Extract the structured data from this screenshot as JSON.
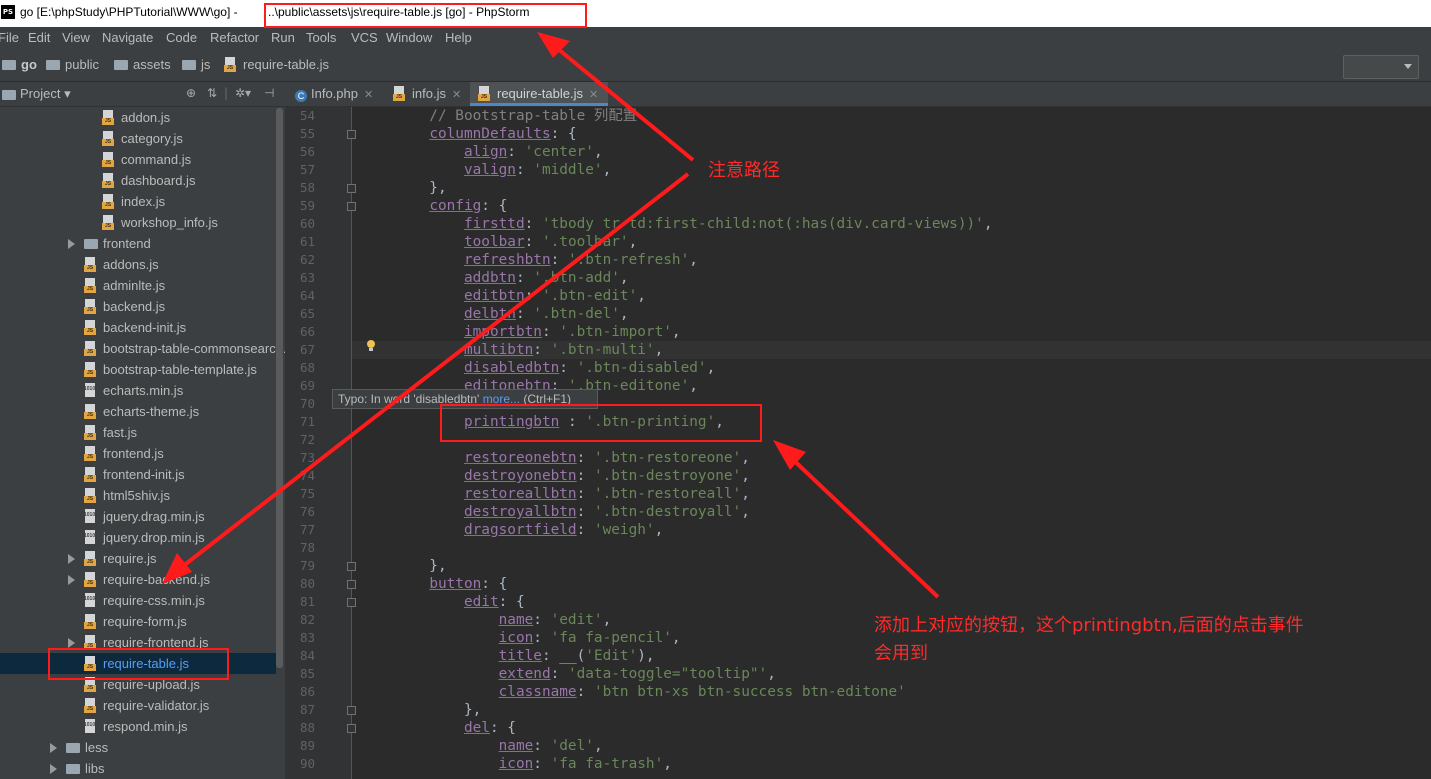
{
  "window": {
    "app_icon": "PS",
    "title_prefix": "go [E:\\phpStudy\\PHPTutorial\\WWW\\go] -",
    "title_path": "..\\public\\assets\\js\\require-table.js [go] - PhpStorm"
  },
  "menu": [
    "File",
    "Edit",
    "View",
    "Navigate",
    "Code",
    "Refactor",
    "Run",
    "Tools",
    "VCS",
    "Window",
    "Help"
  ],
  "breadcrumb": [
    "go",
    "public",
    "assets",
    "js",
    "require-table.js"
  ],
  "project_panel": {
    "title": "Project",
    "tree": [
      {
        "label": "addon.js",
        "icon": "js-file-icon"
      },
      {
        "label": "category.js",
        "icon": "js-file-icon"
      },
      {
        "label": "command.js",
        "icon": "js-file-icon"
      },
      {
        "label": "dashboard.js",
        "icon": "js-file-icon"
      },
      {
        "label": "index.js",
        "icon": "js-file-icon"
      },
      {
        "label": "workshop_info.js",
        "icon": "js-file-icon"
      },
      {
        "label": "frontend",
        "icon": "folder-icon"
      },
      {
        "label": "addons.js",
        "icon": "js-file-icon"
      },
      {
        "label": "adminlte.js",
        "icon": "js-file-icon"
      },
      {
        "label": "backend.js",
        "icon": "js-file-icon"
      },
      {
        "label": "backend-init.js",
        "icon": "js-file-icon"
      },
      {
        "label": "bootstrap-table-commonsearch.js",
        "icon": "js-file-icon"
      },
      {
        "label": "bootstrap-table-template.js",
        "icon": "js-file-icon"
      },
      {
        "label": "echarts.min.js",
        "icon": "binary-file-icon"
      },
      {
        "label": "echarts-theme.js",
        "icon": "js-file-icon"
      },
      {
        "label": "fast.js",
        "icon": "js-file-icon"
      },
      {
        "label": "frontend.js",
        "icon": "js-file-icon"
      },
      {
        "label": "frontend-init.js",
        "icon": "js-file-icon"
      },
      {
        "label": "html5shiv.js",
        "icon": "js-file-icon"
      },
      {
        "label": "jquery.drag.min.js",
        "icon": "binary-file-icon"
      },
      {
        "label": "jquery.drop.min.js",
        "icon": "binary-file-icon"
      },
      {
        "label": "require.js",
        "icon": "js-file-icon"
      },
      {
        "label": "require-backend.js",
        "icon": "js-file-icon"
      },
      {
        "label": "require-css.min.js",
        "icon": "binary-file-icon"
      },
      {
        "label": "require-form.js",
        "icon": "js-file-icon"
      },
      {
        "label": "require-frontend.js",
        "icon": "js-file-icon"
      },
      {
        "label": "require-table.js",
        "icon": "js-file-icon",
        "selected": true
      },
      {
        "label": "require-upload.js",
        "icon": "js-file-icon"
      },
      {
        "label": "require-validator.js",
        "icon": "js-file-icon"
      },
      {
        "label": "respond.min.js",
        "icon": "binary-file-icon"
      },
      {
        "label": "less",
        "icon": "folder-icon"
      },
      {
        "label": "libs",
        "icon": "folder-icon"
      }
    ]
  },
  "tabs": [
    {
      "label": "Info.php",
      "icon": "php-class-icon"
    },
    {
      "label": "info.js",
      "icon": "js-file-icon"
    },
    {
      "label": "require-table.js",
      "icon": "js-file-icon",
      "active": true
    }
  ],
  "editor": {
    "line_numbers": [
      "54",
      "55",
      "56",
      "57",
      "58",
      "59",
      "60",
      "61",
      "62",
      "63",
      "64",
      "65",
      "66",
      "67",
      "68",
      "69",
      "70",
      "71",
      "72",
      "73",
      "74",
      "75",
      "76",
      "77",
      "78",
      "79",
      "80",
      "81",
      "82",
      "83",
      "84",
      "85",
      "86",
      "87",
      "88",
      "89",
      "90"
    ],
    "lines": [
      "        // Bootstrap-table 列配置",
      "        columnDefaults: {",
      "            align: 'center',",
      "            valign: 'middle',",
      "        },",
      "        config: {",
      "            firsttd: 'tbody tr td:first-child:not(:has(div.card-views))',",
      "            toolbar: '.toolbar',",
      "            refreshbtn: '.btn-refresh',",
      "            addbtn: '.btn-add',",
      "            editbtn: '.btn-edit',",
      "            delbtn: '.btn-del',",
      "            importbtn: '.btn-import',",
      "            multibtn: '.btn-multi',",
      "            disabledbtn: '.btn-disabled',",
      "            editonebtn: '.btn-editone',",
      "",
      "            printingbtn : '.btn-printing',",
      "",
      "            restoreonebtn: '.btn-restoreone',",
      "            destroyonebtn: '.btn-destroyone',",
      "            restoreallbtn: '.btn-restoreall',",
      "            destroyallbtn: '.btn-destroyall',",
      "            dragsortfield: 'weigh',",
      "",
      "        },",
      "        button: {",
      "            edit: {",
      "                name: 'edit',",
      "                icon: 'fa fa-pencil',",
      "                title: __('Edit'),",
      "                extend: 'data-toggle=\"tooltip\"',",
      "                classname: 'btn btn-xs btn-success btn-editone'",
      "            },",
      "            del: {",
      "                name: 'del',",
      "                icon: 'fa fa-trash',"
    ]
  },
  "tooltip": {
    "text": "Typo: In word 'disabledbtn'",
    "link": "more...",
    "shortcut": "(Ctrl+F1)"
  },
  "annotations": {
    "path_note": "注意路径",
    "button_note_line1": "添加上对应的按钮，这个printingbtn,后面的点击事件",
    "button_note_line2": "会用到",
    "color": "#ff1b1b"
  }
}
